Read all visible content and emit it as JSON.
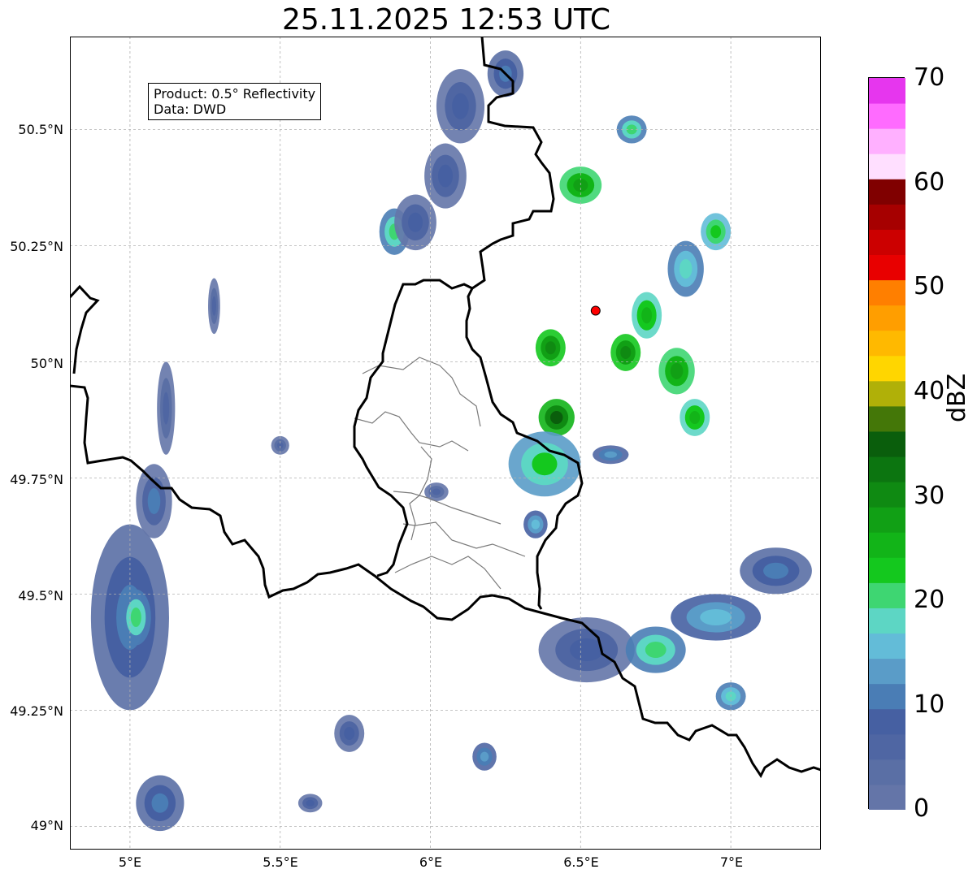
{
  "title": "25.11.2025 12:53 UTC",
  "info": {
    "product": "Product: 0.5° Reflectivity",
    "data": "Data: DWD"
  },
  "axes": {
    "y_labels": [
      "50.5°N",
      "50.25°N",
      "50°N",
      "49.75°N",
      "49.5°N",
      "49.25°N",
      "49°N"
    ],
    "x_labels": [
      "5°E",
      "5.5°E",
      "6°E",
      "6.5°E",
      "7°E"
    ],
    "lon_range": [
      4.8,
      7.3
    ],
    "lat_range": [
      48.95,
      50.7
    ],
    "grid": true
  },
  "radar_site": {
    "lon": 6.55,
    "lat": 50.11,
    "color": "#ff0000"
  },
  "colorbar": {
    "label": "dBZ",
    "ticks": [
      "70",
      "60",
      "50",
      "40",
      "30",
      "20",
      "10",
      "0"
    ],
    "min": 0,
    "max": 70,
    "colors": [
      "#6475a8",
      "#5a6fa5",
      "#4f66a3",
      "#4660a2",
      "#4a7db5",
      "#5a9cc8",
      "#63bcd8",
      "#5dd6c4",
      "#3ed672",
      "#14c81e",
      "#12b418",
      "#11a015",
      "#0f8a12",
      "#0c7510",
      "#0a5e0c",
      "#447708",
      "#b0b008",
      "#ffd600",
      "#ffb900",
      "#ff9e00",
      "#ff7f00",
      "#e80000",
      "#cc0000",
      "#a60000",
      "#800000",
      "#ffdfff",
      "#ffb0ff",
      "#ff6bff",
      "#e636ee"
    ]
  },
  "echoes": [
    {
      "lon": 5.0,
      "lat": 49.45,
      "rx": 0.13,
      "ry": 0.2,
      "dbz": 12
    },
    {
      "lon": 5.02,
      "lat": 49.45,
      "rx": 0.05,
      "ry": 0.06,
      "dbz": 20
    },
    {
      "lon": 5.08,
      "lat": 49.7,
      "rx": 0.06,
      "ry": 0.08,
      "dbz": 10
    },
    {
      "lon": 5.12,
      "lat": 49.9,
      "rx": 0.03,
      "ry": 0.1,
      "dbz": 6
    },
    {
      "lon": 5.28,
      "lat": 50.12,
      "rx": 0.02,
      "ry": 0.06,
      "dbz": 6
    },
    {
      "lon": 5.1,
      "lat": 49.05,
      "rx": 0.08,
      "ry": 0.06,
      "dbz": 12
    },
    {
      "lon": 6.05,
      "lat": 50.4,
      "rx": 0.07,
      "ry": 0.07,
      "dbz": 9
    },
    {
      "lon": 6.1,
      "lat": 50.55,
      "rx": 0.08,
      "ry": 0.08,
      "dbz": 8
    },
    {
      "lon": 6.25,
      "lat": 50.62,
      "rx": 0.06,
      "ry": 0.05,
      "dbz": 12
    },
    {
      "lon": 5.88,
      "lat": 50.28,
      "rx": 0.05,
      "ry": 0.05,
      "dbz": 20
    },
    {
      "lon": 5.95,
      "lat": 50.3,
      "rx": 0.07,
      "ry": 0.06,
      "dbz": 9
    },
    {
      "lon": 6.5,
      "lat": 50.38,
      "rx": 0.07,
      "ry": 0.04,
      "dbz": 28
    },
    {
      "lon": 6.67,
      "lat": 50.5,
      "rx": 0.05,
      "ry": 0.03,
      "dbz": 20
    },
    {
      "lon": 6.95,
      "lat": 50.28,
      "rx": 0.05,
      "ry": 0.04,
      "dbz": 24
    },
    {
      "lon": 6.85,
      "lat": 50.2,
      "rx": 0.06,
      "ry": 0.06,
      "dbz": 18
    },
    {
      "lon": 6.72,
      "lat": 50.1,
      "rx": 0.05,
      "ry": 0.05,
      "dbz": 26
    },
    {
      "lon": 6.65,
      "lat": 50.02,
      "rx": 0.05,
      "ry": 0.04,
      "dbz": 30
    },
    {
      "lon": 6.82,
      "lat": 49.98,
      "rx": 0.06,
      "ry": 0.05,
      "dbz": 28
    },
    {
      "lon": 6.88,
      "lat": 49.88,
      "rx": 0.05,
      "ry": 0.04,
      "dbz": 26
    },
    {
      "lon": 6.4,
      "lat": 50.03,
      "rx": 0.05,
      "ry": 0.04,
      "dbz": 30
    },
    {
      "lon": 6.42,
      "lat": 49.88,
      "rx": 0.06,
      "ry": 0.04,
      "dbz": 34
    },
    {
      "lon": 6.38,
      "lat": 49.78,
      "rx": 0.12,
      "ry": 0.07,
      "dbz": 22
    },
    {
      "lon": 6.35,
      "lat": 49.65,
      "rx": 0.04,
      "ry": 0.03,
      "dbz": 16
    },
    {
      "lon": 6.52,
      "lat": 49.38,
      "rx": 0.16,
      "ry": 0.07,
      "dbz": 8
    },
    {
      "lon": 6.75,
      "lat": 49.38,
      "rx": 0.1,
      "ry": 0.05,
      "dbz": 20
    },
    {
      "lon": 6.95,
      "lat": 49.45,
      "rx": 0.15,
      "ry": 0.05,
      "dbz": 16
    },
    {
      "lon": 7.15,
      "lat": 49.55,
      "rx": 0.12,
      "ry": 0.05,
      "dbz": 12
    },
    {
      "lon": 7.0,
      "lat": 49.28,
      "rx": 0.05,
      "ry": 0.03,
      "dbz": 18
    },
    {
      "lon": 5.73,
      "lat": 49.2,
      "rx": 0.05,
      "ry": 0.04,
      "dbz": 8
    },
    {
      "lon": 6.18,
      "lat": 49.15,
      "rx": 0.04,
      "ry": 0.03,
      "dbz": 14
    },
    {
      "lon": 5.6,
      "lat": 49.05,
      "rx": 0.04,
      "ry": 0.02,
      "dbz": 8
    },
    {
      "lon": 5.5,
      "lat": 49.82,
      "rx": 0.03,
      "ry": 0.02,
      "dbz": 6
    },
    {
      "lon": 6.02,
      "lat": 49.72,
      "rx": 0.04,
      "ry": 0.02,
      "dbz": 7
    },
    {
      "lon": 6.6,
      "lat": 49.8,
      "rx": 0.06,
      "ry": 0.02,
      "dbz": 14
    }
  ]
}
